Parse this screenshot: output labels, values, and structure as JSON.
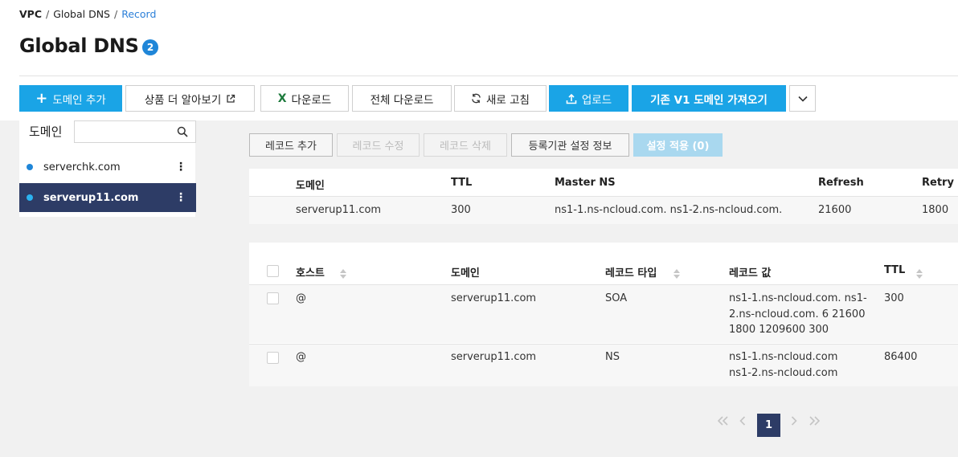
{
  "breadcrumb": {
    "root": "VPC",
    "parent": "Global DNS",
    "current": "Record"
  },
  "page": {
    "title": "Global DNS",
    "count": "2"
  },
  "toolbar": {
    "add_domain": "도메인 추가",
    "learn_more": "상품 더 알아보기",
    "download": "다운로드",
    "download_all": "전체 다운로드",
    "refresh": "새로 고침",
    "upload": "업로드",
    "import_v1": "기존 V1 도메인 가져오기"
  },
  "sidebar": {
    "label": "도메인",
    "search_placeholder": "",
    "items": [
      {
        "name": "serverchk.com",
        "selected": false
      },
      {
        "name": "serverup11.com",
        "selected": true
      }
    ]
  },
  "actions": {
    "add_record": "레코드 추가",
    "edit_record": "레코드 수정",
    "delete_record": "레코드 삭제",
    "registrar_info": "등록기관 설정 정보",
    "apply_settings": "설정 적용 (0)"
  },
  "soa_table": {
    "headers": {
      "domain": "도메인",
      "ttl": "TTL",
      "master_ns": "Master NS",
      "refresh": "Refresh",
      "retry": "Retry"
    },
    "row": {
      "domain": "serverup11.com",
      "ttl": "300",
      "master_ns": "ns1-1.ns-ncloud.com. ns1-2.ns-ncloud.com.",
      "refresh": "21600",
      "retry": "1800"
    }
  },
  "record_table": {
    "headers": {
      "host": "호스트",
      "domain": "도메인",
      "type": "레코드 타입",
      "value": "레코드 값",
      "ttl": "TTL"
    },
    "rows": [
      {
        "host": "@",
        "domain": "serverup11.com",
        "type": "SOA",
        "value_lines": [
          "ns1-1.ns-ncloud.com. ns1-",
          "2.ns-ncloud.com. 6 21600",
          "1800 1209600 300"
        ],
        "ttl": "300"
      },
      {
        "host": "@",
        "domain": "serverup11.com",
        "type": "NS",
        "value_lines": [
          "ns1-1.ns-ncloud.com",
          "ns1-2.ns-ncloud.com"
        ],
        "ttl": "86400"
      }
    ]
  },
  "pagination": {
    "current": "1"
  },
  "colors": {
    "primary": "#1aa4e6",
    "selected_bg": "#2d3c66",
    "badge": "#1f86d8",
    "excel_green": "#1d7a3c"
  }
}
